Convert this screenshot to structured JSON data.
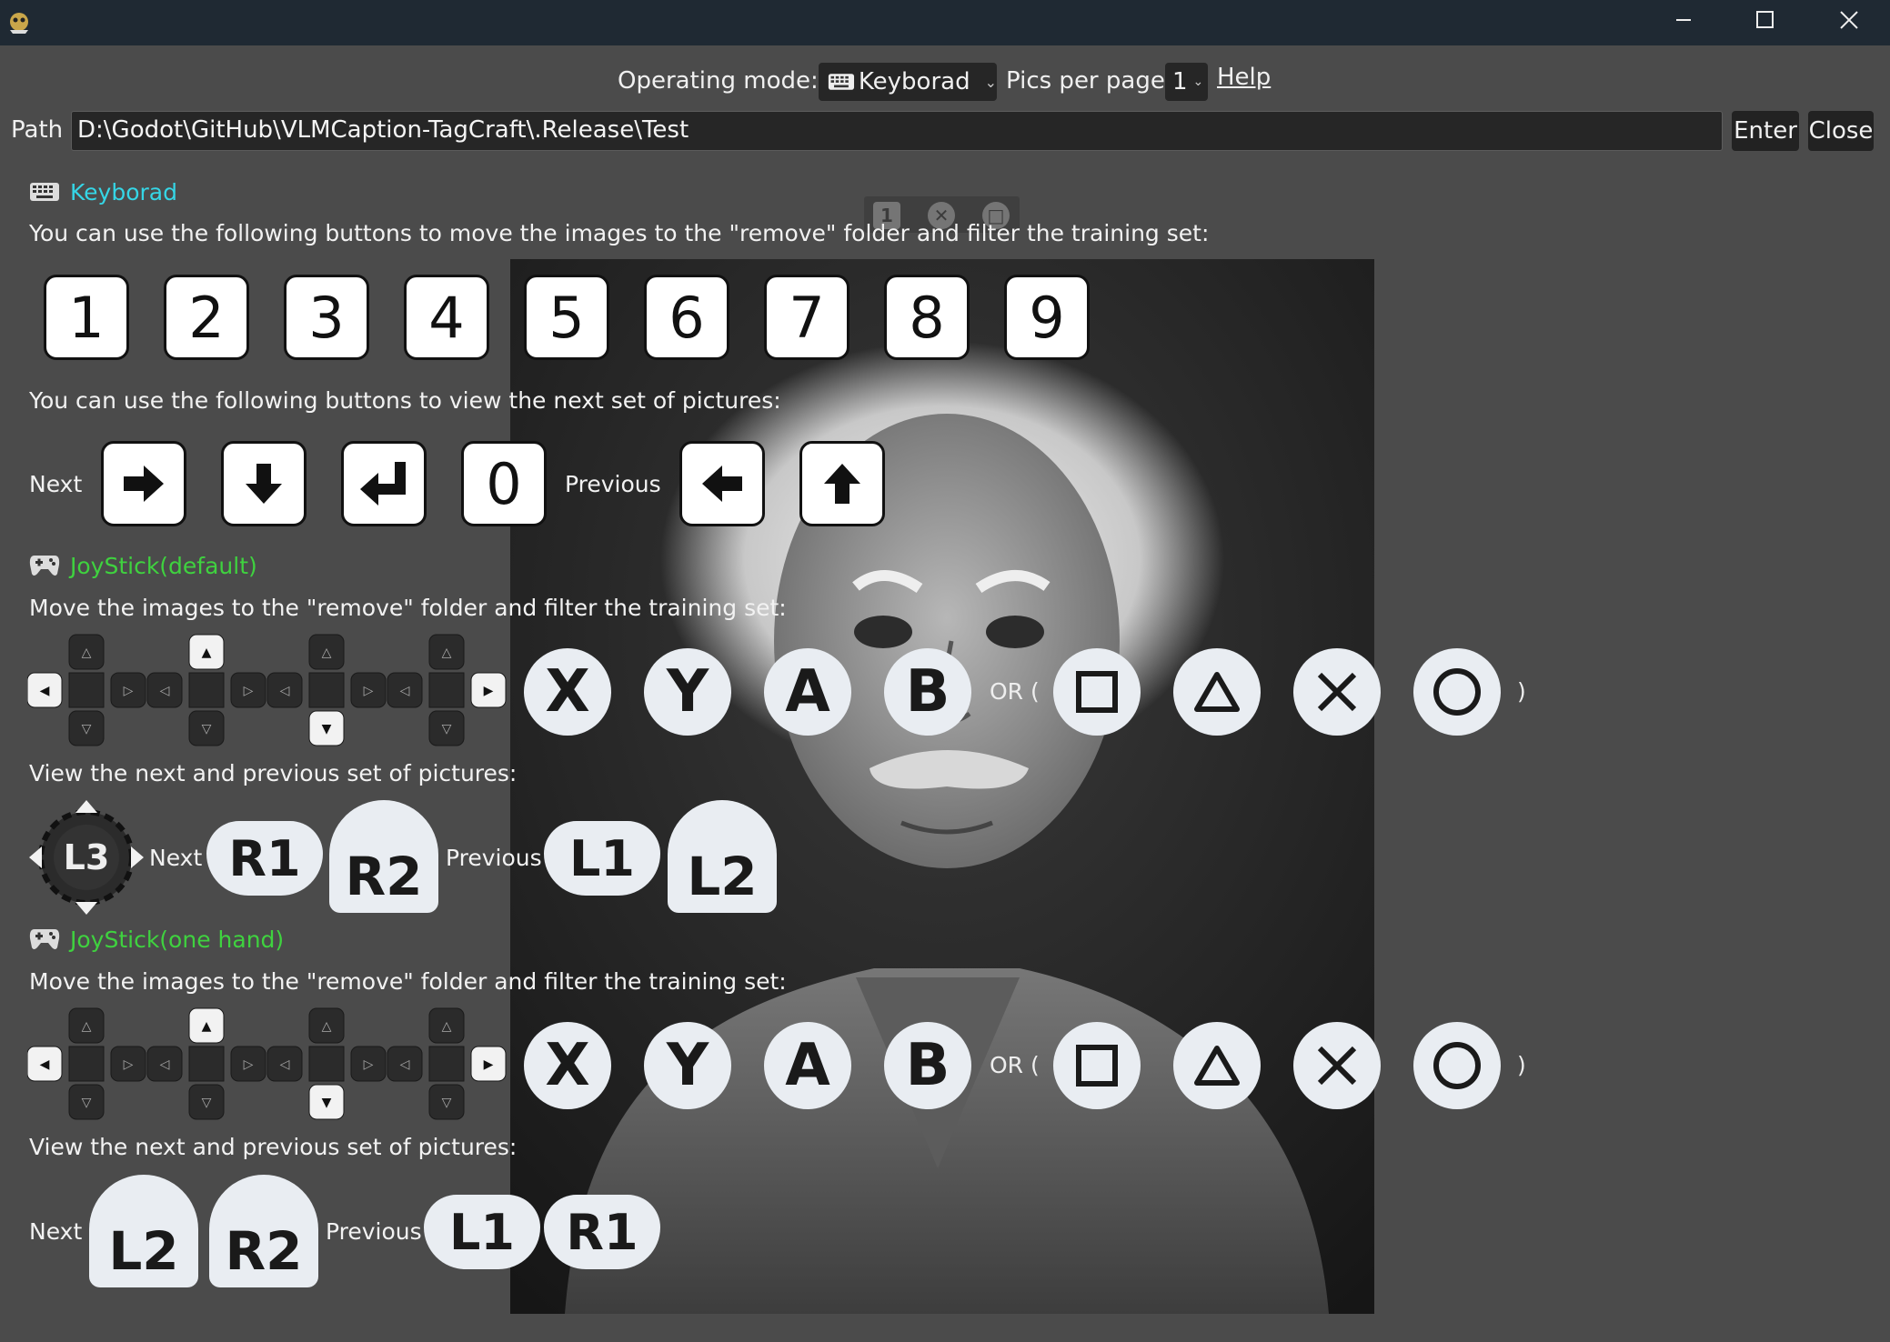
{
  "window": {
    "min_icon": "minimize-icon",
    "max_icon": "maximize-icon",
    "close_icon": "close-icon"
  },
  "toolbar": {
    "mode_label": "Operating mode:",
    "mode_value": "Keyborad",
    "pics_label": "Pics per page:",
    "pics_value": "1",
    "help_label": "Help"
  },
  "path": {
    "label": "Path",
    "value": "D:\\Godot\\GitHub\\VLMCaption-TagCraft\\.Release\\Test",
    "enter_label": "Enter",
    "close_label": "Close"
  },
  "mini_toolbar": {
    "page": "1"
  },
  "keyboard": {
    "title": "Keyborad",
    "remove_text": "You can use the following buttons to move the images to the \"remove\" folder and filter the training set:",
    "number_keys": [
      "1",
      "2",
      "3",
      "4",
      "5",
      "6",
      "7",
      "8",
      "9"
    ],
    "nav_text": "You can use the following buttons to view the next set of pictures:",
    "next_label": "Next",
    "next_zero": "0",
    "previous_label": "Previous"
  },
  "joy_default": {
    "title": "JoyStick(default)",
    "remove_text": "Move the images to the \"remove\" folder and filter the training set:",
    "face_xbox": [
      "X",
      "Y",
      "A",
      "B"
    ],
    "or_label": "OR (",
    "close_paren": ")",
    "nav_text": "View the next and previous set of pictures:",
    "stick": "L3",
    "next_label": "Next",
    "r1": "R1",
    "r2": "R2",
    "previous_label": "Previous",
    "l1": "L1",
    "l2": "L2"
  },
  "joy_onehand": {
    "title": "JoyStick(one hand)",
    "remove_text": "Move the images to the \"remove\" folder and filter the training set:",
    "face_xbox": [
      "X",
      "Y",
      "A",
      "B"
    ],
    "or_label": "OR (",
    "close_paren": ")",
    "nav_text": "View the next and previous set of pictures:",
    "next_label": "Next",
    "l2": "L2",
    "r2": "R2",
    "previous_label": "Previous",
    "l1": "L1",
    "r1": "R1"
  },
  "colors": {
    "keyboard_header": "#35d6e6",
    "joystick_header": "#3fd23f",
    "background": "#4b4b4b",
    "titlebar": "#1f2933"
  }
}
